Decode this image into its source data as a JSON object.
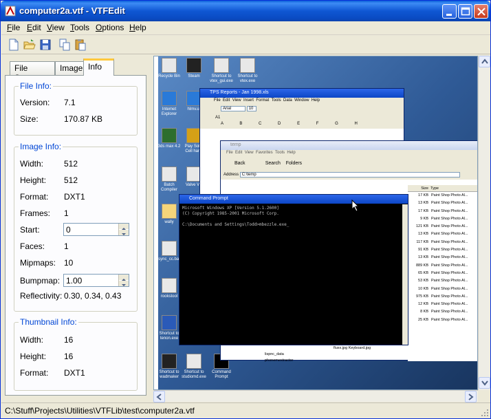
{
  "window": {
    "title": "computer2a.vtf - VTFEdit",
    "status": "C:\\Stuff\\Projects\\Utilities\\VTFLib\\test\\computer2a.vtf"
  },
  "menu": [
    {
      "acc": "F",
      "rest": "ile"
    },
    {
      "acc": "E",
      "rest": "dit"
    },
    {
      "acc": "V",
      "rest": "iew"
    },
    {
      "acc": "T",
      "rest": "ools"
    },
    {
      "acc": "O",
      "rest": "ptions"
    },
    {
      "acc": "H",
      "rest": "elp"
    }
  ],
  "toolbar_icons": [
    "new-file-icon",
    "open-folder-icon",
    "save-disk-icon",
    "copy-icon",
    "paste-icon"
  ],
  "tabs": [
    "File System",
    "Image",
    "Info"
  ],
  "active_tab": "Info",
  "file_info": {
    "title": "File Info:",
    "version_label": "Version:",
    "version": "7.1",
    "size_label": "Size:",
    "size": "170.87 KB"
  },
  "image_info": {
    "title": "Image Info:",
    "width_label": "Width:",
    "width": "512",
    "height_label": "Height:",
    "height": "512",
    "format_label": "Format:",
    "format": "DXT1",
    "frames_label": "Frames:",
    "frames": "1",
    "start_label": "Start:",
    "start": "0",
    "faces_label": "Faces:",
    "faces": "1",
    "mipmaps_label": "Mipmaps:",
    "mipmaps": "10",
    "bumpmap_label": "Bumpmap:",
    "bumpmap": "1.00",
    "reflectivity_label": "Reflectivity:",
    "reflectivity": "0.30, 0.34, 0.43"
  },
  "thumbnail_info": {
    "title": "Thumbnail Info:",
    "width_label": "Width:",
    "width": "16",
    "height_label": "Height:",
    "height": "16",
    "format_label": "Format:",
    "format": "DXT1"
  },
  "preview": {
    "desktop_icons": [
      "Recycle Bin",
      "Steam",
      "Shortcut to vtex_gui.exe",
      "Shortcut to vtex.exe",
      "Internet Explorer",
      "hlmv.ut",
      "3ds max 4.2",
      "Play Solitr Cell hand",
      "Batch Compiler",
      "Valve VP",
      "wally",
      "sync_cc.bat",
      "rookstool",
      "Shortcut to tenon.exe",
      "Shortcut to wadmaker",
      "Shortcut to studiomd.exe",
      "Command Prompt"
    ],
    "excel_title": "TPS Reports - Jan 1998.xls",
    "excel_menu": [
      "File",
      "Edit",
      "View",
      "Insert",
      "Format",
      "Tools",
      "Data",
      "Window",
      "Help"
    ],
    "excel_font": "Arial",
    "excel_size": "10",
    "excel_cell": "A1",
    "excel_cols": [
      "A",
      "B",
      "C",
      "D",
      "E",
      "F",
      "G",
      "H"
    ],
    "explorer_title": "temp",
    "explorer_menu": [
      "File",
      "Edit",
      "View",
      "Favorites",
      "Tools",
      "Help"
    ],
    "explorer_back": "Back",
    "explorer_search": "Search",
    "explorer_folders": "Folders",
    "explorer_address_label": "Address",
    "explorer_address": "C:\\temp",
    "cmd_title": "Command Prompt",
    "cmd_lines": "Microsoft Windows XP [Version 5.1.2600]\n(C) Copyright 1985-2001 Microsoft Corp.\n\nC:\\Documents and Settings\\Todd>mbezzle.exe_",
    "file_header_size": "Size",
    "file_header_type": "Type",
    "file_sizes": "17 KB\n13 KB\n17 KB\n9 KB\n121 KB\n13 KB\n117 KB\n91 KB\n13 KB\n889 KB\n65 KB\n53 KB\n10 KB\n975 KB\n12 KB\n8 KB\n25 KB",
    "file_type": "Paint Shop Photo Al...",
    "file_names": "fluxx.jpg\nKeyboard.jpg",
    "folder_names": "lispnc_data\nphonemextractor"
  }
}
